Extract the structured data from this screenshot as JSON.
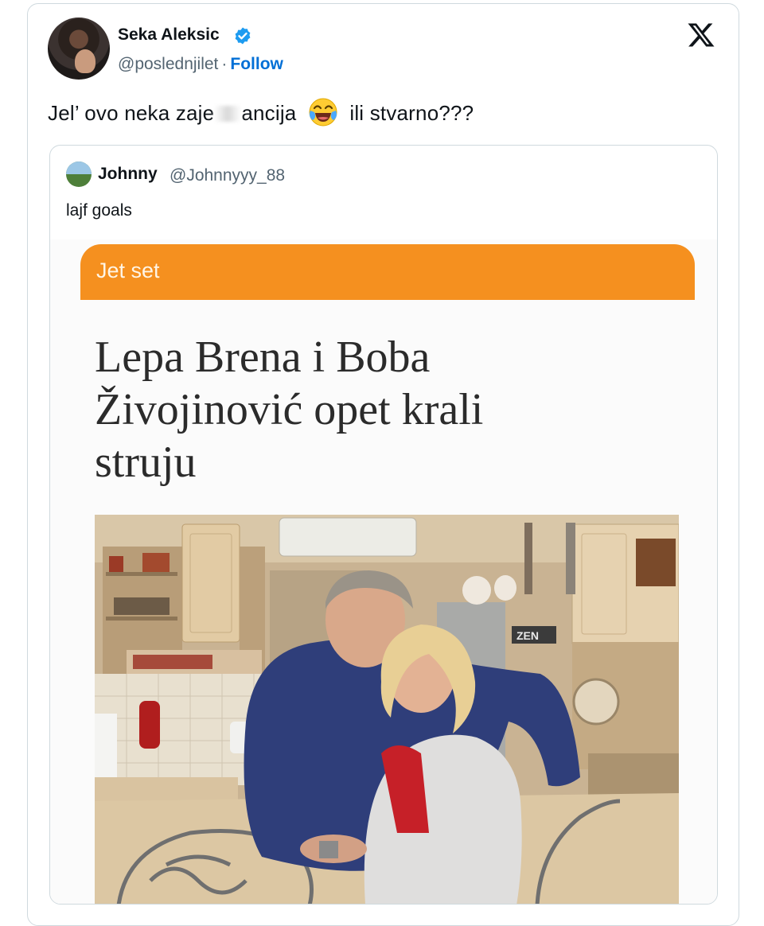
{
  "tweet": {
    "author_name": "Seka Aleksic",
    "author_handle": "@poslednjilet",
    "separator": "·",
    "follow_label": "Follow",
    "text_part1": "Jel’ ovo neka zaje",
    "text_part2": "ancija",
    "text_part3": "ili stvarno???",
    "emoji": "face-with-tears-of-joy"
  },
  "quoted": {
    "author_name": "Johnny",
    "author_handle": "@Johnnyyy_88",
    "text": "lajf goals",
    "article": {
      "section": "Jet set",
      "headline_line1": "Lepa Brena i Boba",
      "headline_line2": "Živojinović opet krali",
      "headline_line3": "struju",
      "fridge_label": "ZEN"
    }
  },
  "colors": {
    "accent_blue": "#006fd6",
    "section_orange": "#f5901f",
    "verified_blue": "#1d9bf0"
  }
}
